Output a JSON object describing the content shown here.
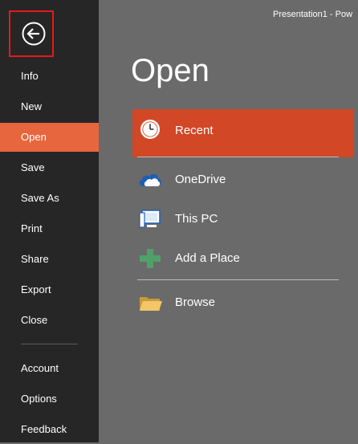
{
  "window": {
    "title": "Presentation1 - Pow"
  },
  "colors": {
    "sidebar": "#262626",
    "active_nav": "#e8663e",
    "selected_location": "#d24726",
    "back_highlight": "#e21b1b",
    "content_bg": "#6a6a6a"
  },
  "sidebar": {
    "back_icon": "back-arrow-icon",
    "items": [
      {
        "label": "Info"
      },
      {
        "label": "New"
      },
      {
        "label": "Open",
        "active": true
      },
      {
        "label": "Save"
      },
      {
        "label": "Save As"
      },
      {
        "label": "Print"
      },
      {
        "label": "Share"
      },
      {
        "label": "Export"
      },
      {
        "label": "Close"
      },
      {
        "label": "Account"
      },
      {
        "label": "Options"
      },
      {
        "label": "Feedback"
      }
    ]
  },
  "main": {
    "heading": "Open",
    "locations": [
      {
        "label": "Recent",
        "icon": "clock-icon",
        "selected": true
      },
      {
        "label": "OneDrive",
        "icon": "cloud-icon"
      },
      {
        "label": "This PC",
        "icon": "computer-icon"
      },
      {
        "label": "Add a Place",
        "icon": "plus-icon"
      },
      {
        "label": "Browse",
        "icon": "folder-icon"
      }
    ]
  }
}
